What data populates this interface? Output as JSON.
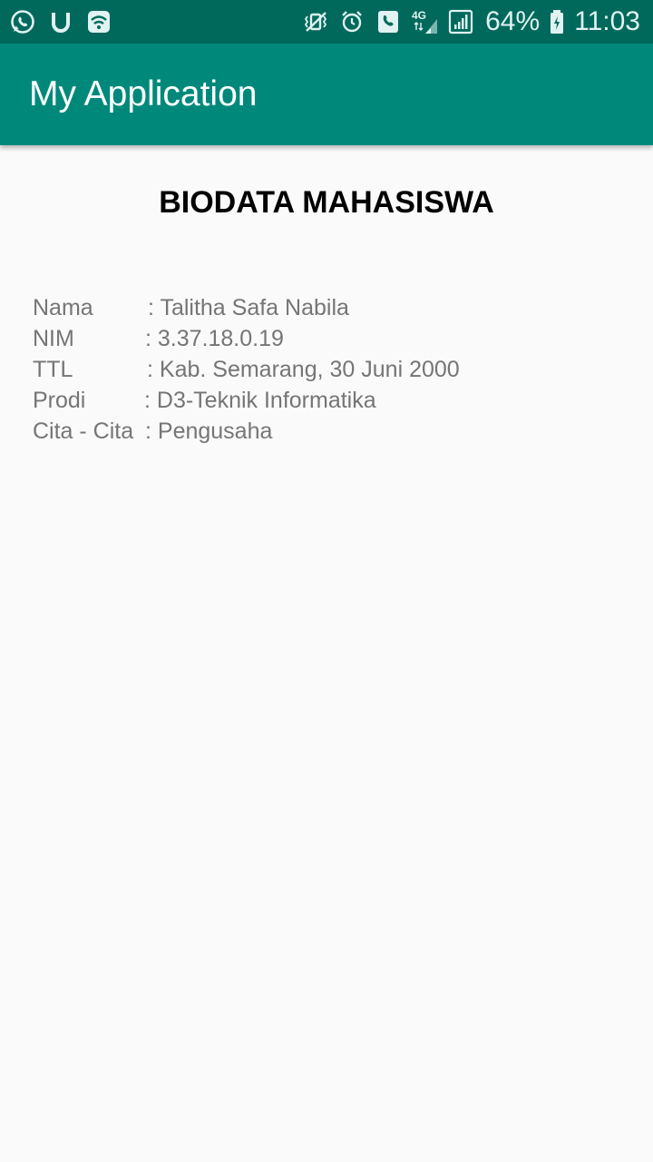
{
  "status_bar": {
    "left_icons": [
      "whatsapp-icon",
      "u-app-icon",
      "wifi-icon"
    ],
    "right_icons": [
      "vibrate-icon",
      "alarm-icon",
      "call-icon",
      "signal-4g-icon",
      "cellular-signal-icon"
    ],
    "network_type": "4G",
    "battery_percent": "64%",
    "time": "11:03"
  },
  "app_bar": {
    "title": "My Application"
  },
  "main": {
    "heading": "BIODATA MAHASISWA",
    "rows": [
      {
        "label": "Nama",
        "value": ": Talitha Safa Nabila"
      },
      {
        "label": "NIM",
        "value": ": 3.37.18.0.19"
      },
      {
        "label": "TTL",
        "value": ": Kab. Semarang, 30 Juni 2000"
      },
      {
        "label": "Prodi",
        "value": ": D3-Teknik Informatika"
      },
      {
        "label": "Cita - Cita",
        "value": ": Pengusaha"
      }
    ]
  },
  "colors": {
    "status_bar": "#00695c",
    "app_bar": "#00897b",
    "background": "#fafafa",
    "heading_text": "#000000",
    "body_text": "#757575"
  }
}
